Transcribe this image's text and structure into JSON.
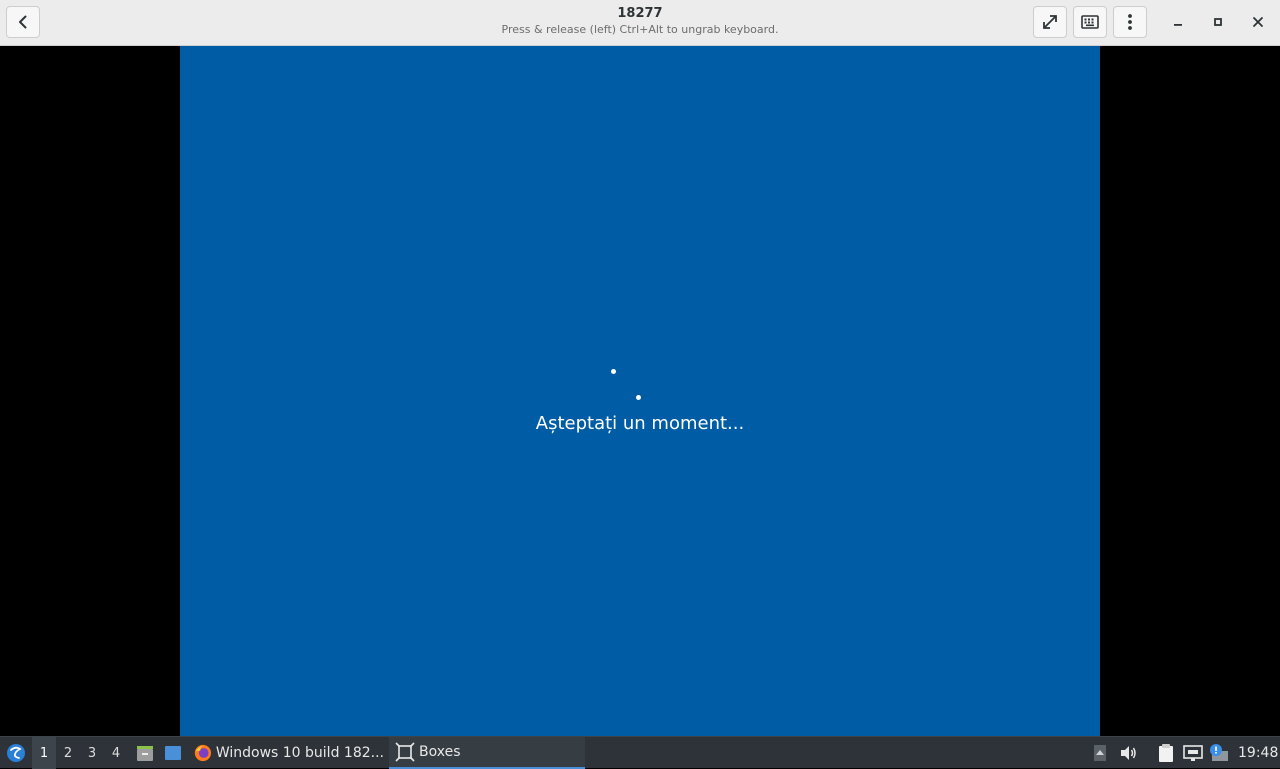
{
  "window": {
    "title": "18277",
    "subtitle": "Press & release (left) Ctrl+Alt to ungrab keyboard."
  },
  "icons": {
    "back": "chevron-left-icon",
    "fullscreen": "fullscreen-icon",
    "keyboard": "keyboard-icon",
    "menu": "kebab-menu-icon",
    "minimize": "minimize-icon",
    "maximize": "maximize-icon",
    "close": "close-icon"
  },
  "vm": {
    "background_color": "#005da5",
    "status_text": "Așteptați un moment..."
  },
  "taskbar": {
    "workspaces": [
      "1",
      "2",
      "3",
      "4"
    ],
    "active_workspace": "1",
    "tasks": [
      {
        "label": "Windows 10 build 182...",
        "icon": "firefox-icon"
      },
      {
        "label": "Boxes",
        "icon": "boxes-icon",
        "active": true
      }
    ],
    "clock": "19:48"
  },
  "colors": {
    "header": "#ececec",
    "taskbar": "#2d3338",
    "accent": "#4a90d9"
  }
}
